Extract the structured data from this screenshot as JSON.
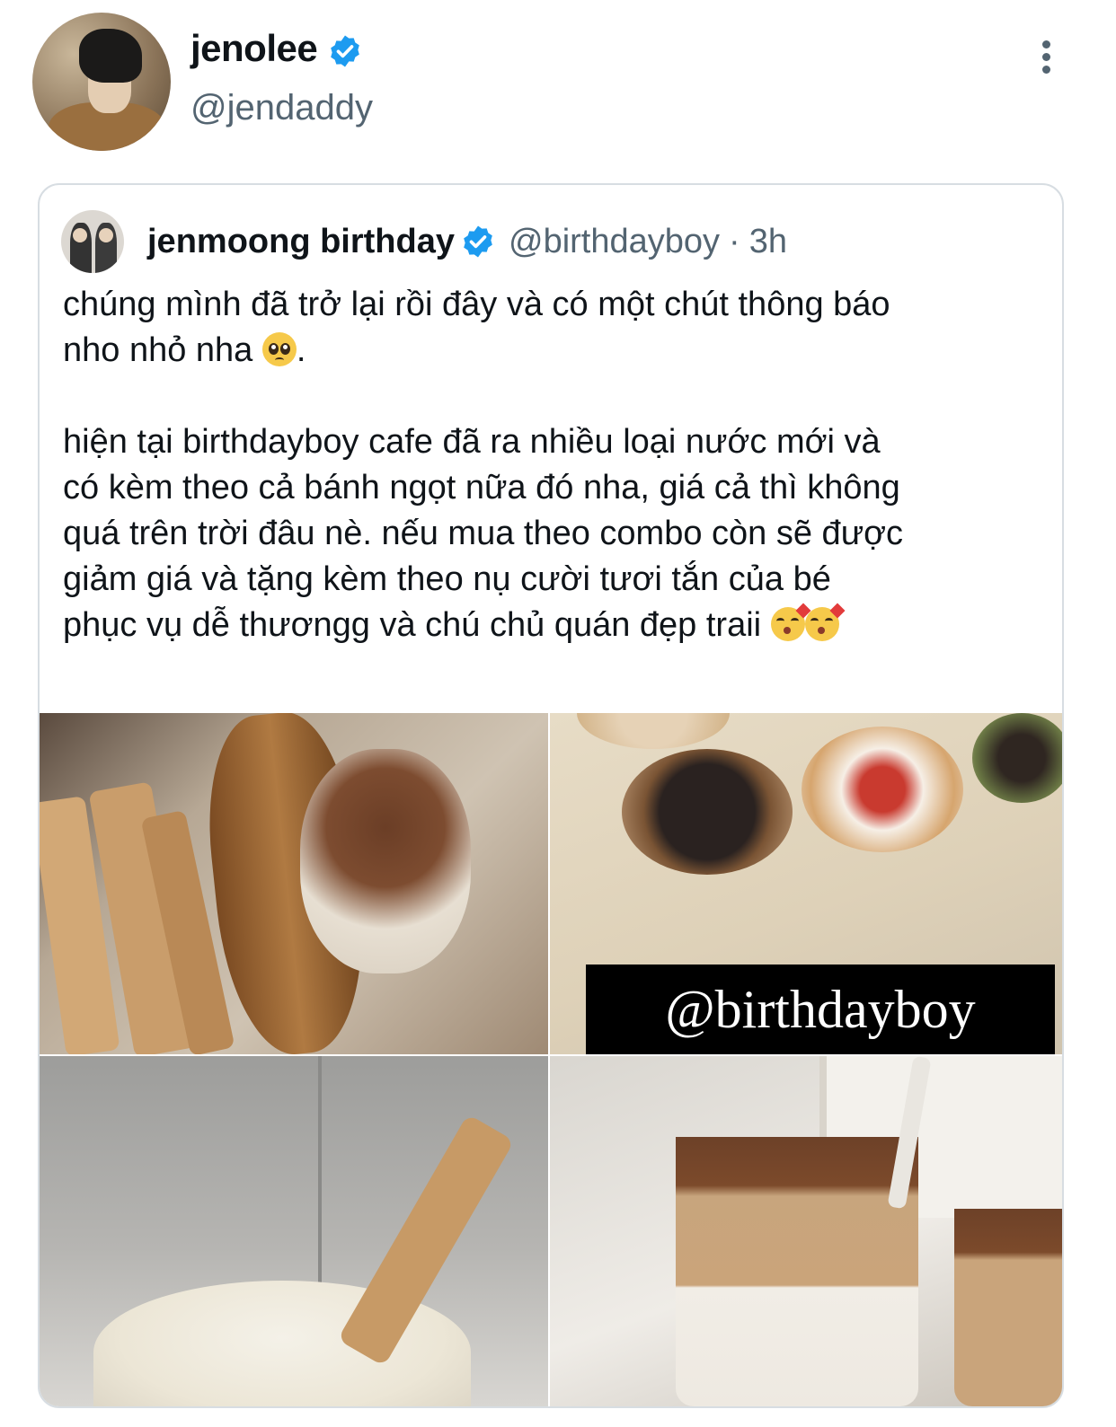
{
  "tweet": {
    "author_name": "jenolee",
    "author_handle": "@jendaddy",
    "verified_color": "#1d9bf0"
  },
  "quoted": {
    "author_name": "jenmoong birthday",
    "author_handle": "@birthdayboy",
    "separator": "·",
    "time": "3h",
    "text_line1": "chúng mình đã trở lại rồi đây và có một chút thông báo\nnho nhỏ nha ",
    "text_line1_end": ".",
    "text_body": "\n\nhiện tại birthdayboy cafe đã ra nhiều loại nước mới và\ncó kèm theo cả bánh ngọt nữa đó nha, giá cả thì không\nquá trên trời đâu nè. nếu mua theo combo còn sẽ được\ngiảm giá và tặng kèm theo nụ cười tươi tắn của bé\nphục vụ dễ thươngg và chú chủ quán đẹp traii ",
    "emoji_1": "pleading-face",
    "emoji_2": "face-blowing-kiss",
    "media_overlay": "@birthdayboy"
  },
  "icons": {
    "more": "more-vertical-icon",
    "verified": "verified-badge-icon"
  }
}
